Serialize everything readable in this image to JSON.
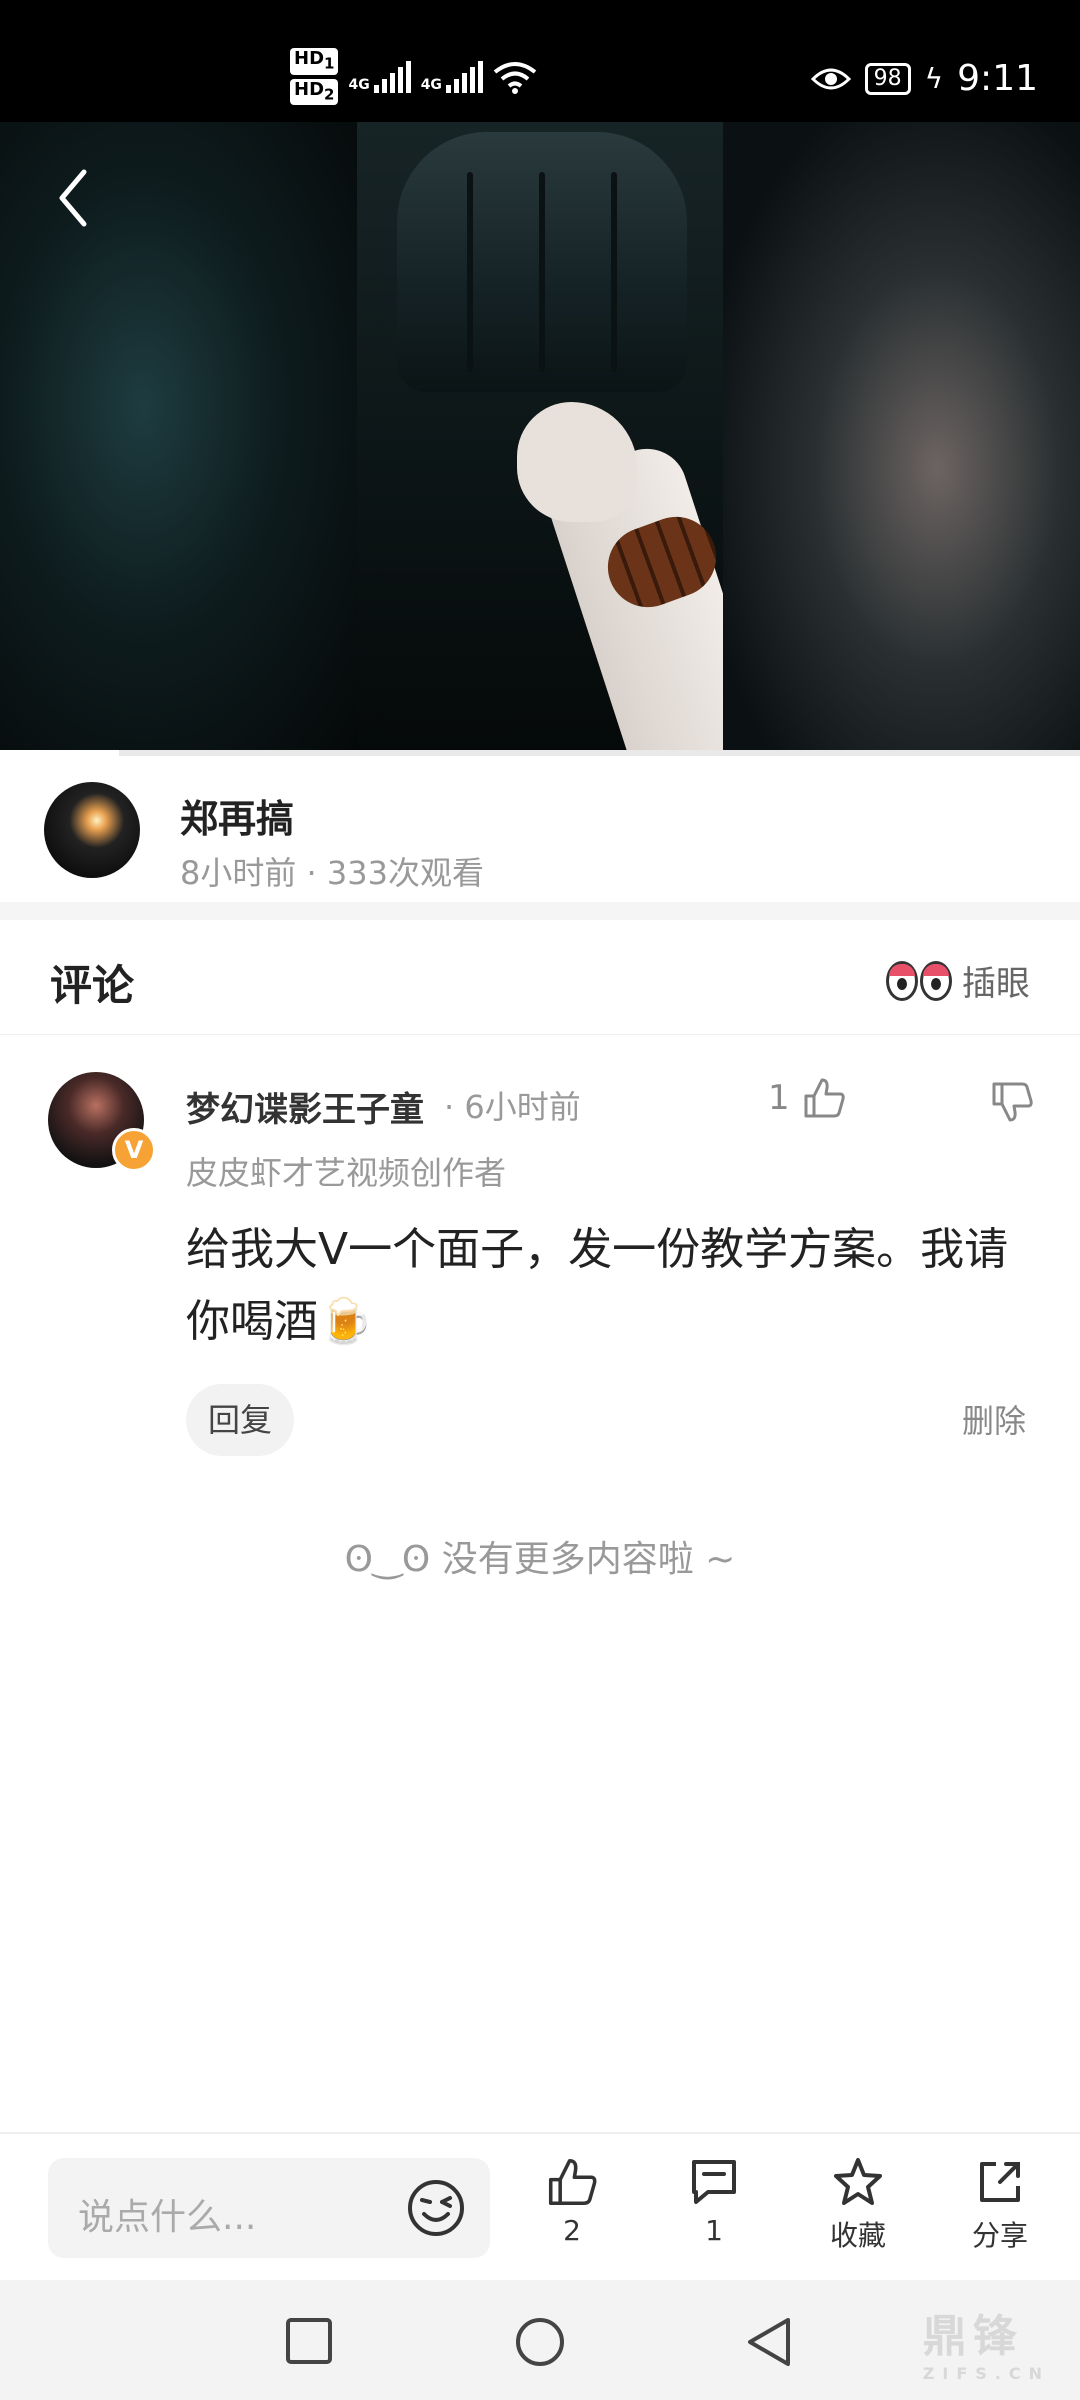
{
  "status_bar": {
    "hd1": "HD",
    "hd1_sub": "1",
    "hd2": "HD",
    "hd2_sub": "2",
    "net1": "4G",
    "net2": "4G",
    "battery": "98",
    "time": "9:11"
  },
  "video": {
    "progress": 0.11
  },
  "author": {
    "name": "郑再搞",
    "meta": "8小时前 · 333次观看"
  },
  "comments": {
    "title": "评论",
    "eye_label": "插眼",
    "items": [
      {
        "user": "梦幻谍影王子童",
        "time": "· 6小时前",
        "likes": "1",
        "role": "皮皮虾才艺视频创作者",
        "text": "给我大V一个面子，发一份教学方案。我请你喝酒🍺",
        "badge": "V",
        "reply_label": "回复",
        "delete_label": "删除"
      }
    ],
    "no_more": "没有更多内容啦 ~"
  },
  "bottom_bar": {
    "input_placeholder": "说点什么...",
    "like_count": "2",
    "comment_count": "1",
    "favorite_label": "收藏",
    "share_label": "分享"
  },
  "watermark": {
    "main": "鼎锋",
    "sub": "ZIFS.CN"
  }
}
